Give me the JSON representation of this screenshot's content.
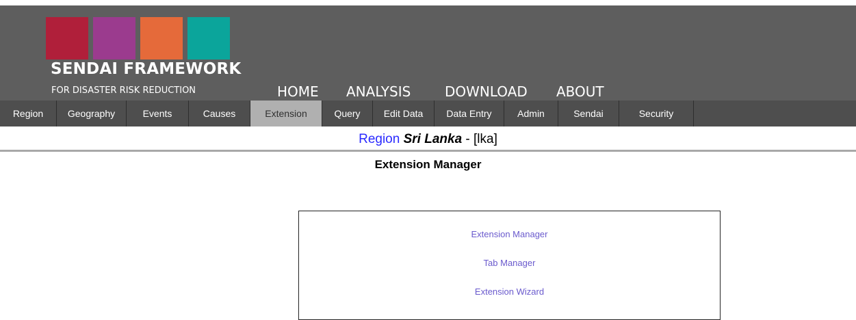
{
  "logo": {
    "title": "SENDAI FRAMEWORK",
    "subtitle": "FOR DISASTER RISK REDUCTION",
    "colors": [
      "#b01f3a",
      "#9b3b8e",
      "#e56a3a",
      "#0ba59b"
    ]
  },
  "main_nav": [
    "HOME",
    "ANALYSIS",
    "DOWNLOAD",
    "ABOUT"
  ],
  "tabs": [
    "Region",
    "Geography",
    "Events",
    "Causes",
    "Extension",
    "Query",
    "Edit Data",
    "Data Entry",
    "Admin",
    "Sendai",
    "Security"
  ],
  "active_tab": "Extension",
  "region": {
    "label": "Region",
    "name": "Sri Lanka",
    "separator": " - ",
    "code": "[lka]"
  },
  "page_title": "Extension Manager",
  "menu": [
    "Extension Manager",
    "Tab Manager",
    "Extension Wizard"
  ],
  "colors": {
    "header_bg": "#5e5e5e",
    "tabbar_bg": "#4e4e4e",
    "active_tab_bg": "#b0b0b0",
    "region_label": "#2a2aff",
    "link": "#6a5acd"
  }
}
